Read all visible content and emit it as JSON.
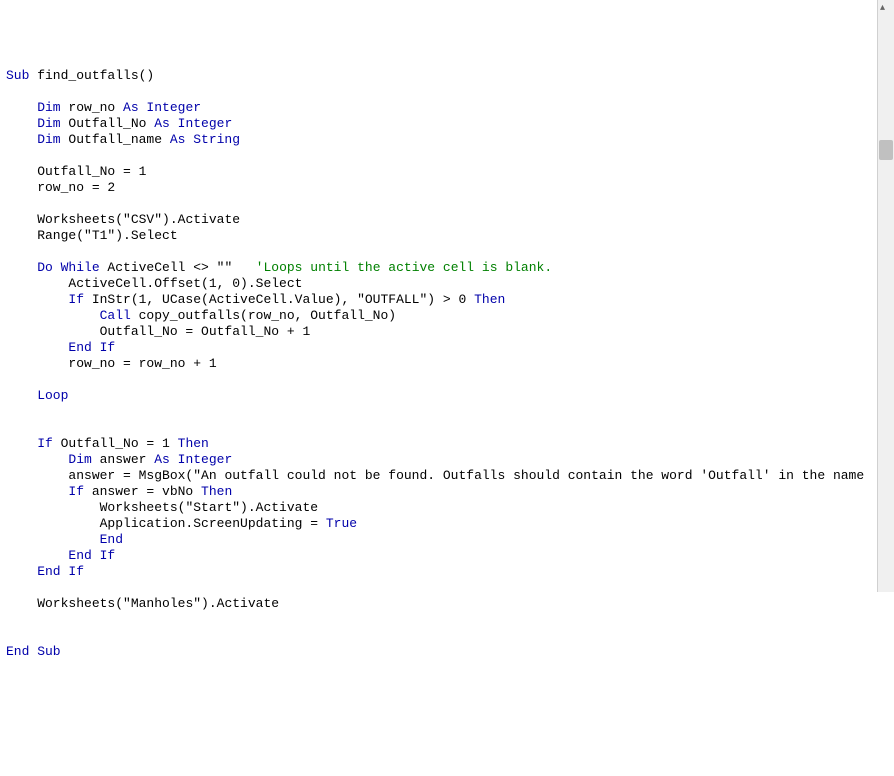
{
  "code": {
    "line1a": "Sub",
    "line1b": " find_outfalls()",
    "line3a": "    Dim",
    "line3b": " row_no ",
    "line3c": "As Integer",
    "line4a": "    Dim",
    "line4b": " Outfall_No ",
    "line4c": "As Integer",
    "line5a": "    Dim",
    "line5b": " Outfall_name ",
    "line5c": "As String",
    "line7": "    Outfall_No = 1",
    "line8": "    row_no = 2",
    "line10a": "    Worksheets(",
    "line10b": "\"CSV\"",
    "line10c": ").Activate",
    "line11a": "    Range(",
    "line11b": "\"T1\"",
    "line11c": ").Select",
    "line13a": "    Do While",
    "line13b": " ActiveCell <> ",
    "line13c": "\"\"",
    "line13d": "   ",
    "line13e": "'Loops until the active cell is blank.",
    "line14": "        ActiveCell.Offset(1, 0).Select",
    "line15a": "        If",
    "line15b": " InStr(1, UCase(ActiveCell.Value), ",
    "line15c": "\"OUTFALL\"",
    "line15d": ") > 0 ",
    "line15e": "Then",
    "line16a": "            Call",
    "line16b": " copy_outfalls(row_no, Outfall_No)",
    "line17": "            Outfall_No = Outfall_No + 1",
    "line18": "        End If",
    "line19": "        row_no = row_no + 1",
    "line21": "    Loop",
    "line24a": "    If",
    "line24b": " Outfall_No = 1 ",
    "line24c": "Then",
    "line25a": "        Dim",
    "line25b": " answer ",
    "line25c": "As Integer",
    "line26a": "        answer = MsgBox(",
    "line26b": "\"An outfall could not be found. Outfalls should contain the word 'Outfall' in the name",
    "line27a": "        If",
    "line27b": " answer = vbNo ",
    "line27c": "Then",
    "line28a": "            Worksheets(",
    "line28b": "\"Start\"",
    "line28c": ").Activate",
    "line29a": "            Application.ScreenUpdating = ",
    "line29b": "True",
    "line30": "            End",
    "line31": "        End If",
    "line32": "    End If",
    "line34a": "    Worksheets(",
    "line34b": "\"Manholes\"",
    "line34c": ").Activate",
    "line37": "End Sub"
  }
}
